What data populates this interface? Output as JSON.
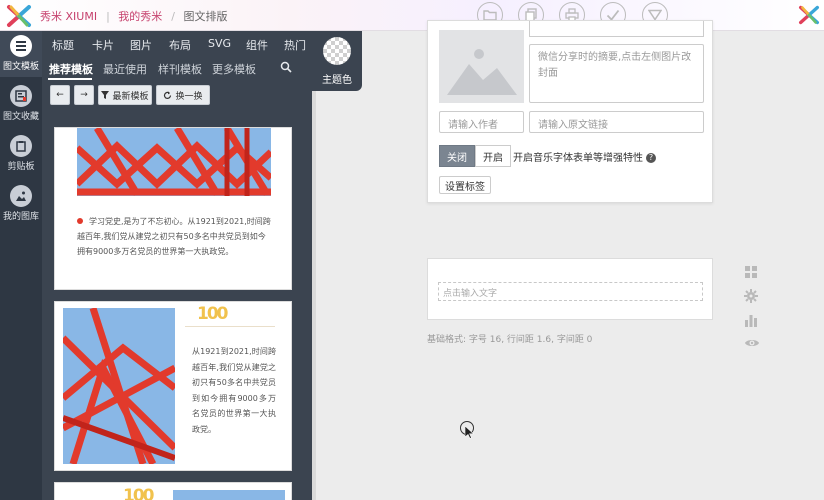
{
  "header": {
    "brand": "秀米 XIUMI",
    "breadcrumb": [
      "我的秀米",
      "图文排版"
    ],
    "toolbar_icons": [
      "folder-icon",
      "copy-icon",
      "print-icon",
      "check-icon",
      "save-dropdown-icon"
    ]
  },
  "rail": {
    "items": [
      {
        "label": "图文模板",
        "icon": "list-icon",
        "active": true
      },
      {
        "label": "图文收藏",
        "icon": "favorites-icon",
        "active": false
      },
      {
        "label": "剪贴板",
        "icon": "clipboard-icon",
        "active": false
      },
      {
        "label": "我的图库",
        "icon": "image-library-icon",
        "active": false
      }
    ]
  },
  "panel": {
    "categories": [
      "标题",
      "卡片",
      "图片",
      "布局",
      "SVG",
      "组件",
      "热门"
    ],
    "subtabs": [
      "推荐模板",
      "最近使用",
      "样刊模板",
      "更多模板"
    ],
    "buttons": {
      "prev": "←",
      "next": "→",
      "latest": "最新模板",
      "refresh": "换一换"
    },
    "cards": [
      {
        "text": "学习党史,是为了不忘初心。从1921到2021,时间跨越百年,我们党从建党之初只有50多名中共党员到如今拥有9000多万名党员的世界第一大执政党。"
      },
      {
        "badge": "100",
        "text": "从1921到2021,时间跨越百年,我们党从建党之初只有50多名中共党员到如今拥有9000多万名党员的世界第一大执政党。"
      },
      {
        "badge": "100"
      }
    ]
  },
  "theme": {
    "label": "主题色"
  },
  "form": {
    "summary_placeholder": "微信分享时的摘要,点击左侧图片改封面",
    "author_placeholder": "请输入作者",
    "source_placeholder": "请输入原文链接",
    "toggle_off": "关闭",
    "toggle_on": "开启",
    "music_label": "开启音乐字体表单等增强特性",
    "tag_button": "设置标签"
  },
  "editor": {
    "placeholder": "点击输入文字",
    "format_line": "基础格式: 字号 16, 行间距 1.6, 字间距 0"
  },
  "side_tools": [
    "grid-icon",
    "gear-icon",
    "stats-icon",
    "eye-icon"
  ],
  "colors": {
    "brand": "#c6416d",
    "rail_bg": "#2e3743",
    "panel_bg": "#3b4450",
    "bridge_red": "#e23a2c",
    "sky_blue": "#89b7e6",
    "gold": "#f1c24d"
  }
}
